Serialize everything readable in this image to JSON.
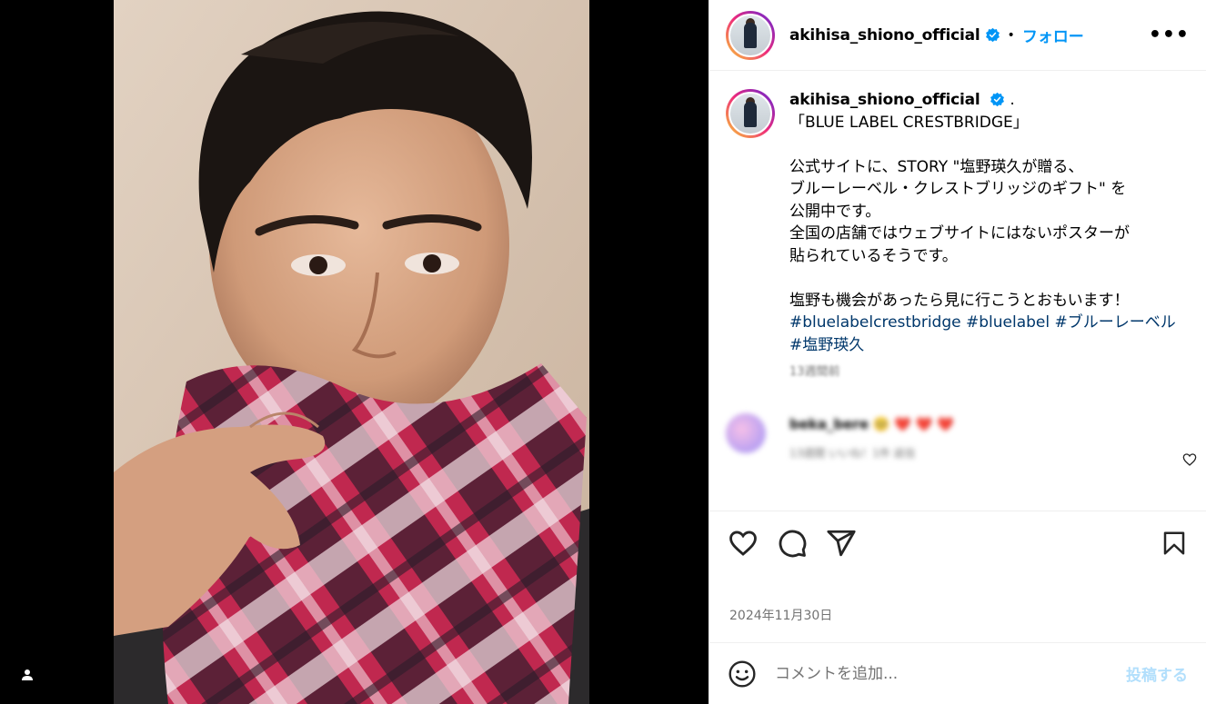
{
  "post": {
    "username": "akihisa_shiono_official",
    "follow_label": "フォロー",
    "separator": "•",
    "more_label": "•••",
    "caption_suffix": ".",
    "caption": "「BLUE LABEL CRESTBRIDGE」\n\n公式サイトに、STORY \"塩野瑛久が贈る、\nブルーレーベル・クレストブリッジのギフト\" を\n公開中です。\n全国の店舗ではウェブサイトにはないポスターが\n貼られているそうです。\n\n塩野も機会があったら見に行こうとおもいます！\n",
    "hashtags": "#bluelabelcrestbridge #bluelabel #ブルーレーベル #塩野瑛久",
    "time_ago": "13週間前",
    "date": "2024年11月30日"
  },
  "comment": {
    "author": "beka_bere",
    "text": "🥺 ❤️ ❤️ ❤️",
    "meta": "13週間   いいね！1件   返信"
  },
  "comment_box": {
    "placeholder": "コメントを追加...",
    "post_label": "投稿する"
  },
  "icons": {
    "verified": "verified-badge-icon",
    "like": "heart-icon",
    "comment": "comment-icon",
    "share": "share-icon",
    "save": "bookmark-icon",
    "emoji": "emoji-icon",
    "tagged_user": "user-icon"
  },
  "colors": {
    "accent": "#0095f6",
    "hashtag": "#00376b",
    "muted": "#737373",
    "post_disabled": "#b2dffc"
  }
}
